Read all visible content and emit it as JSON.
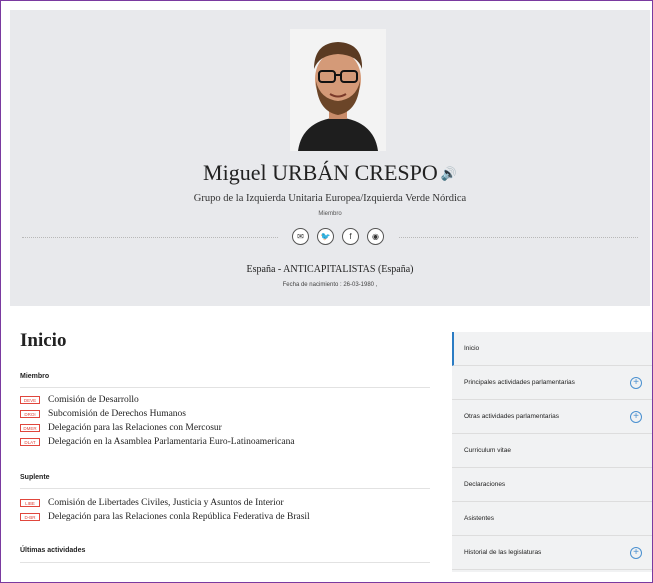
{
  "profile": {
    "name": "Miguel URBÁN CRESPO",
    "speaker_icon": "🔊",
    "group": "Grupo de la Izquierda Unitaria Europea/Izquierda Verde Nórdica",
    "role": "Miembro",
    "country_party": "España - ANTICAPITALISTAS (España)",
    "birth": "Fecha de nacimiento : 26-03-1980 ,"
  },
  "socials": [
    {
      "name": "email-icon",
      "glyph": "✉"
    },
    {
      "name": "twitter-icon",
      "glyph": "🐦"
    },
    {
      "name": "facebook-icon",
      "glyph": "f"
    },
    {
      "name": "website-icon",
      "glyph": "◉"
    }
  ],
  "main": {
    "title": "Inicio",
    "sections": [
      {
        "heading": "Miembro",
        "items": [
          {
            "badge": "DEVE",
            "label": "Comisión de Desarrollo"
          },
          {
            "badge": "DROI",
            "label": "Subcomisión de Derechos Humanos"
          },
          {
            "badge": "DMER",
            "label": "Delegación para las Relaciones con Mercosur"
          },
          {
            "badge": "DLAT",
            "label": "Delegación en la Asamblea Parlamentaria Euro-Latinoamericana"
          }
        ]
      },
      {
        "heading": "Suplente",
        "items": [
          {
            "badge": "LIBE",
            "label": "Comisión de Libertades Civiles, Justicia y Asuntos de Interior"
          },
          {
            "badge": "D-BR",
            "label": "Delegación para las Relaciones conla República Federativa de Brasil"
          }
        ]
      },
      {
        "heading": "Últimas actividades",
        "items": []
      }
    ]
  },
  "sidebar": {
    "items": [
      {
        "label": "Inicio",
        "active": true,
        "expandable": false
      },
      {
        "label": "Principales actividades parlamentarias",
        "active": false,
        "expandable": true
      },
      {
        "label": "Otras actividades parlamentarias",
        "active": false,
        "expandable": true
      },
      {
        "label": "Curriculum vitae",
        "active": false,
        "expandable": false
      },
      {
        "label": "Declaraciones",
        "active": false,
        "expandable": false
      },
      {
        "label": "Asistentes",
        "active": false,
        "expandable": false
      },
      {
        "label": "Historial de las legislaturas",
        "active": false,
        "expandable": true
      }
    ],
    "expand_glyph": "+"
  },
  "colors": {
    "accent": "#2b7cc4",
    "badge": "#e0463c",
    "header_bg": "#e8e9ec"
  }
}
